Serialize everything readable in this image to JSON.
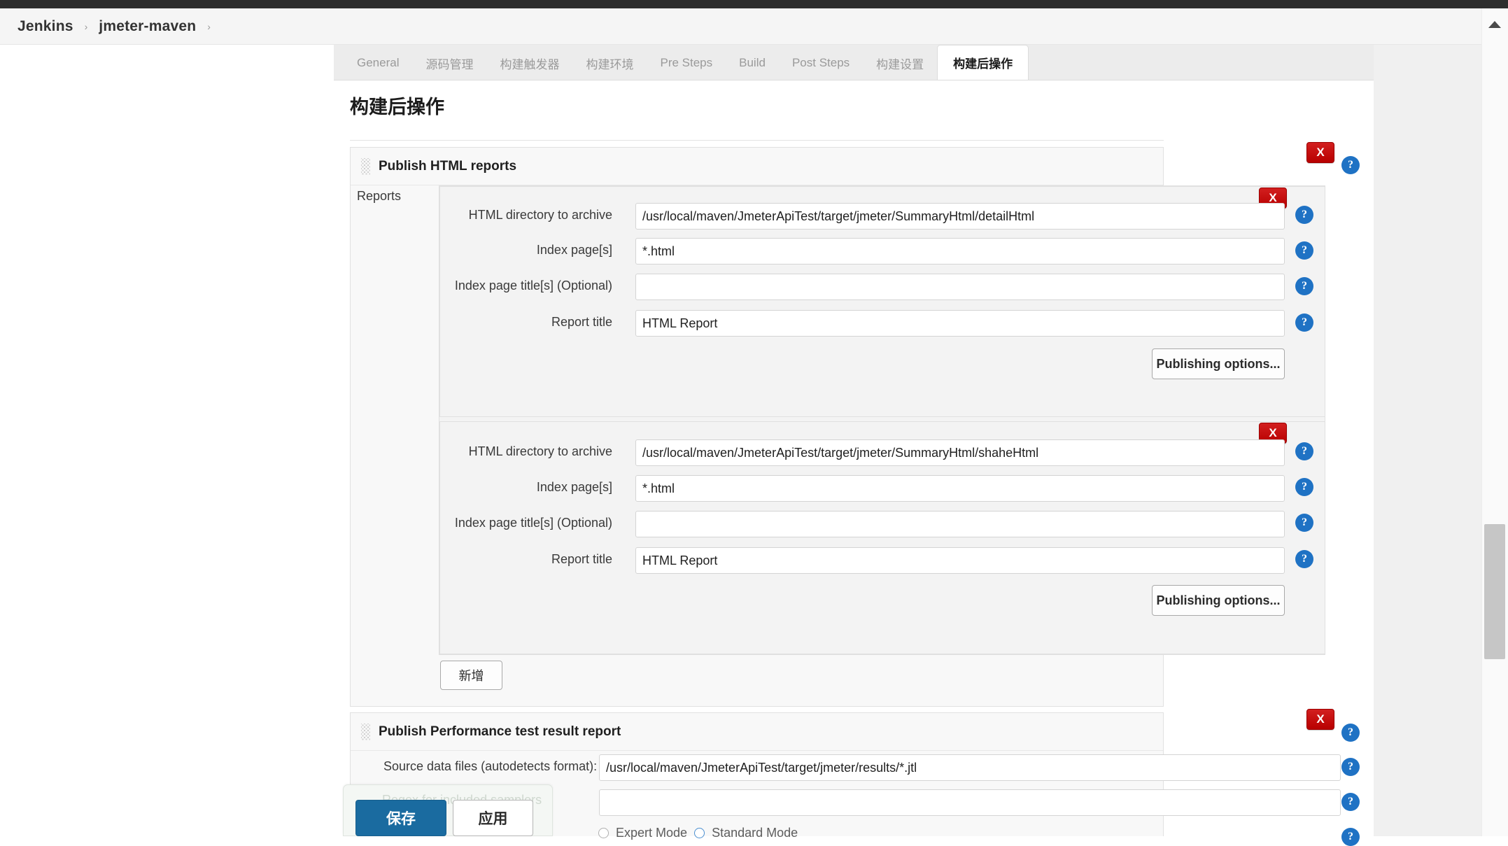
{
  "breadcrumb": {
    "items": [
      "Jenkins",
      "jmeter-maven"
    ],
    "separator": "›"
  },
  "tabs": [
    {
      "label": "General",
      "active": false
    },
    {
      "label": "源码管理",
      "active": false
    },
    {
      "label": "构建触发器",
      "active": false
    },
    {
      "label": "构建环境",
      "active": false
    },
    {
      "label": "Pre Steps",
      "active": false
    },
    {
      "label": "Build",
      "active": false
    },
    {
      "label": "Post Steps",
      "active": false
    },
    {
      "label": "构建设置",
      "active": false
    },
    {
      "label": "构建后操作",
      "active": true
    }
  ],
  "page_title": "构建后操作",
  "sections": [
    {
      "title": "Publish HTML reports",
      "reports_label": "Reports",
      "add_button": "新增",
      "delete_label": "X",
      "help_label": "?",
      "reports": [
        {
          "fields": [
            {
              "label": "HTML directory to archive",
              "value": "/usr/local/maven/JmeterApiTest/target/jmeter/SummaryHtml/detailHtml",
              "placeholder": ""
            },
            {
              "label": "Index page[s]",
              "value": "*.html",
              "placeholder": ""
            },
            {
              "label": "Index page title[s] (Optional)",
              "value": "",
              "placeholder": ""
            },
            {
              "label": "Report title",
              "value": "HTML Report",
              "placeholder": ""
            }
          ],
          "options_button": "Publishing options..."
        },
        {
          "fields": [
            {
              "label": "HTML directory to archive",
              "value": "/usr/local/maven/JmeterApiTest/target/jmeter/SummaryHtml/shaheHtml",
              "placeholder": ""
            },
            {
              "label": "Index page[s]",
              "value": "*.html",
              "placeholder": ""
            },
            {
              "label": "Index page title[s] (Optional)",
              "value": "",
              "placeholder": ""
            },
            {
              "label": "Report title",
              "value": "HTML Report",
              "placeholder": ""
            }
          ],
          "options_button": "Publishing options..."
        }
      ]
    },
    {
      "title": "Publish Performance test result report",
      "source_label": "Source data files (autodetects format):",
      "source_value": "/usr/local/maven/JmeterApiTest/target/jmeter/results/*.jtl",
      "regex_label": "Regex for included samplers",
      "regex_value": "",
      "modes": [
        {
          "label": "Expert Mode",
          "selected": false
        },
        {
          "label": "Standard Mode",
          "selected": true
        }
      ]
    }
  ],
  "footer": {
    "save": "保存",
    "apply": "应用"
  },
  "colors": {
    "accent_blue": "#1a6ba0",
    "delete_red": "#b80000",
    "help_blue": "#1f72c4",
    "topbar_dark": "#2e2e2e"
  }
}
